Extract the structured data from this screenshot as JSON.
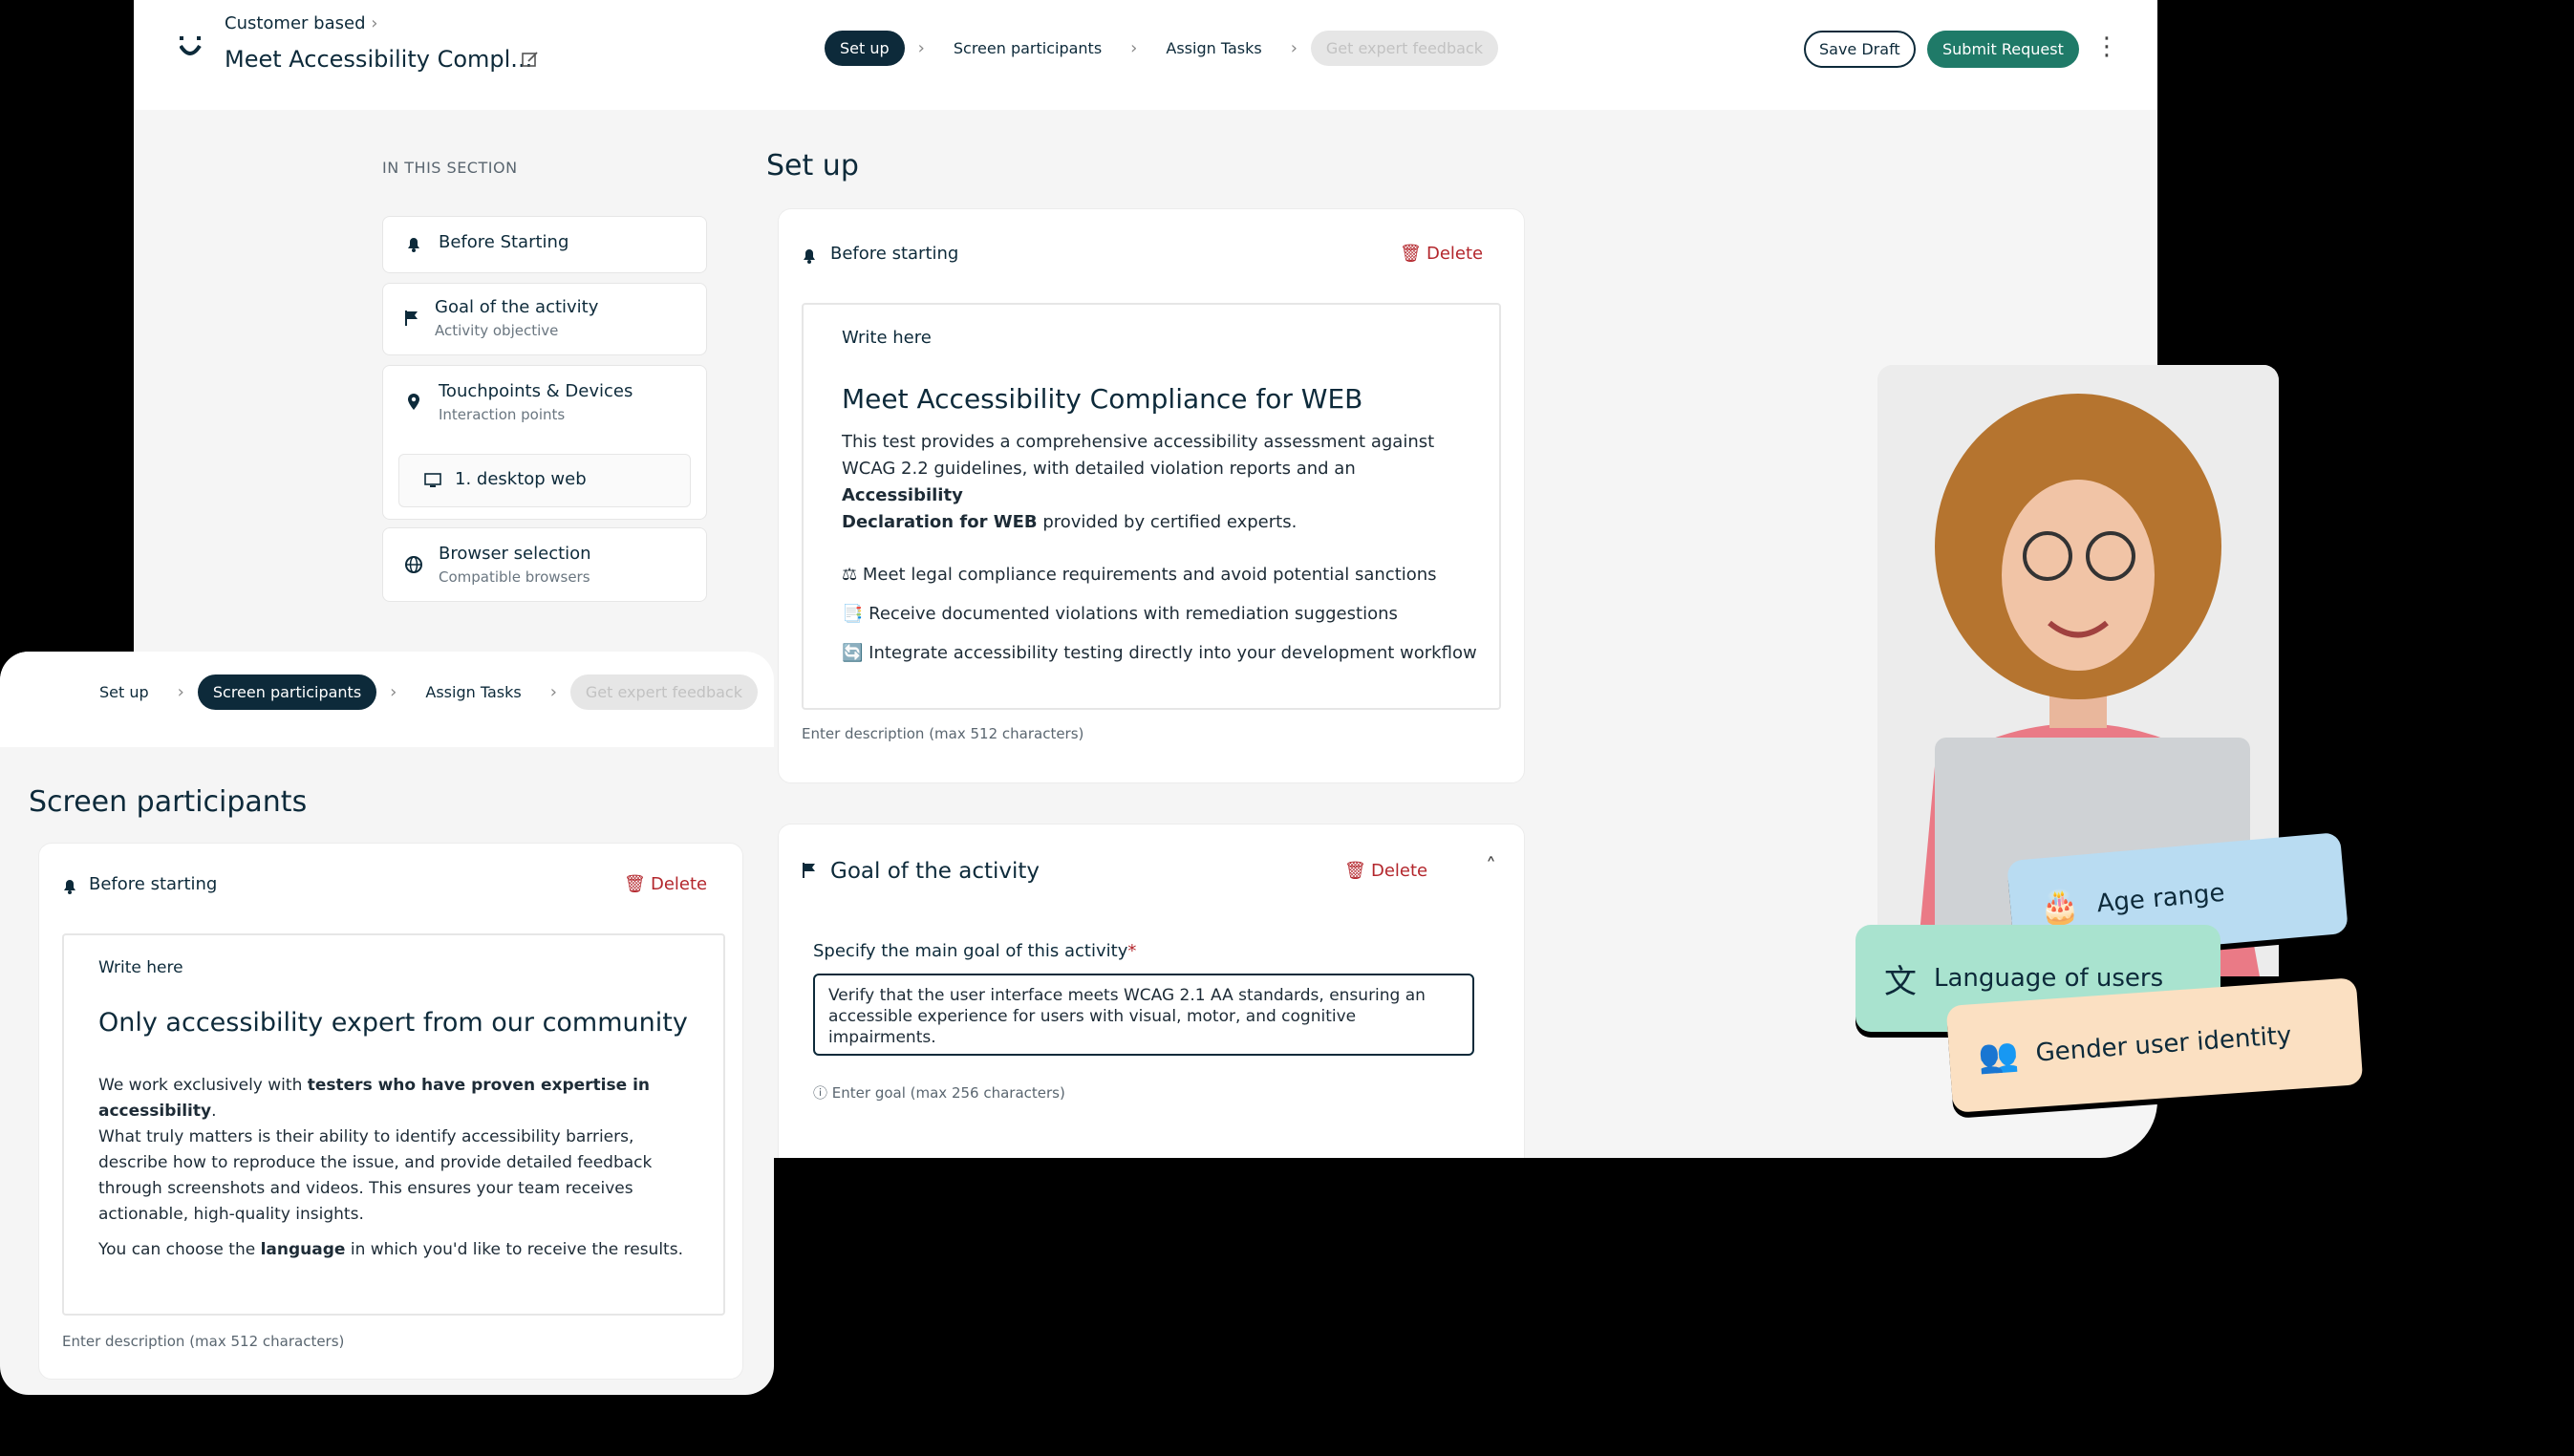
{
  "header": {
    "breadcrumb": "Customer based",
    "title": "Meet Accessibility Compl...",
    "steps": [
      "Set up",
      "Screen participants",
      "Assign Tasks",
      "Get expert feedback"
    ],
    "save_draft": "Save Draft",
    "submit": "Submit Request"
  },
  "nav": {
    "title": "IN THIS SECTION",
    "items": [
      {
        "title": "Before Starting",
        "subtitle": ""
      },
      {
        "title": "Goal of the activity",
        "subtitle": "Activity objective"
      },
      {
        "title": "Touchpoints & Devices",
        "subtitle": "Interaction points"
      },
      {
        "title": "1. desktop web",
        "subtitle": ""
      },
      {
        "title": "Browser selection",
        "subtitle": "Compatible browsers"
      }
    ]
  },
  "setup": {
    "heading": "Set up",
    "before_card": {
      "label": "Before starting",
      "delete": "Delete",
      "write_here": "Write here",
      "editor_title": "Meet Accessibility Compliance for WEB",
      "para_1": "This test provides a comprehensive accessibility assessment against",
      "para_2": "WCAG 2.2 guidelines, with detailed violation reports and an ",
      "para_2_bold": "Accessibility",
      "para_3_bold": "Declaration for WEB",
      "para_3": " provided by certified experts.",
      "bullets": [
        "Meet legal compliance requirements and avoid potential sanctions",
        "Receive documented violations with remediation suggestions",
        "Integrate accessibility testing directly into your development workflow"
      ],
      "hint": "Enter description (max 512 characters)"
    },
    "goal_card": {
      "label": "Goal of the activity",
      "delete": "Delete",
      "field_label": "Specify the main goal of this activity",
      "required_mark": "*",
      "value": "Verify that the user interface meets WCAG 2.1 AA standards, ensuring an accessible experience for users with visual, motor, and cognitive impairments.",
      "hint": "Enter goal (max 256 characters)"
    }
  },
  "overlay": {
    "steps": [
      "Set up",
      "Screen participants",
      "Assign Tasks",
      "Get expert feedback"
    ],
    "heading": "Screen participants",
    "card": {
      "label": "Before starting",
      "delete": "Delete",
      "write_here": "Write here",
      "editor_title": "Only accessibility expert from our community",
      "p1_a": "We work exclusively with ",
      "p1_b": "testers who have proven expertise in",
      "p1_c": "accessibility",
      "p1_d": ".",
      "p2": "What truly matters is their ability to identify accessibility barriers, describe how to reproduce the issue, and provide detailed feedback through screenshots and videos. This ensures your team receives actionable, high-quality insights.",
      "p3_a": "You can choose the ",
      "p3_b": "language",
      "p3_c": " in which you'd like to receive the results.",
      "hint": "Enter description (max 512 characters)"
    }
  },
  "tags": [
    "Age range",
    "Language of users",
    "Gender user identity"
  ],
  "colors": {
    "navy": "#0d2a3a",
    "green": "#1f7a68",
    "delete": "#b3262c",
    "tag_blue": "#b9dcf2",
    "tag_green": "#a9e3cf",
    "tag_peach": "#fbe0c2"
  }
}
